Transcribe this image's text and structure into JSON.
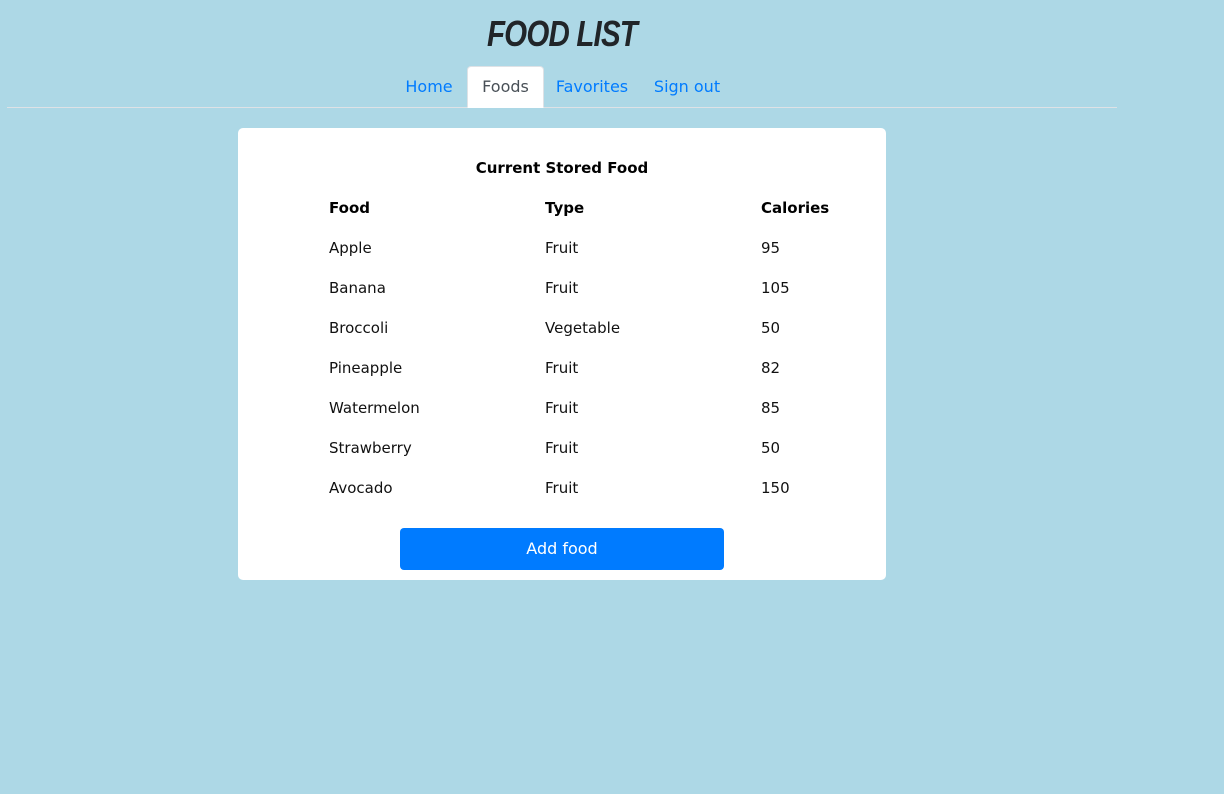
{
  "header": {
    "title": "FOOD LIST"
  },
  "nav": {
    "tabs": [
      {
        "label": "Home",
        "active": false
      },
      {
        "label": "Foods",
        "active": true
      },
      {
        "label": "Favorites",
        "active": false
      },
      {
        "label": "Sign out",
        "active": false
      }
    ]
  },
  "card": {
    "title": "Current Stored Food",
    "columns": [
      "Food",
      "Type",
      "Calories"
    ],
    "rows": [
      {
        "food": "Apple",
        "type": "Fruit",
        "calories": "95"
      },
      {
        "food": "Banana",
        "type": "Fruit",
        "calories": "105"
      },
      {
        "food": "Broccoli",
        "type": "Vegetable",
        "calories": "50"
      },
      {
        "food": "Pineapple",
        "type": "Fruit",
        "calories": "82"
      },
      {
        "food": "Watermelon",
        "type": "Fruit",
        "calories": "85"
      },
      {
        "food": "Strawberry",
        "type": "Fruit",
        "calories": "50"
      },
      {
        "food": "Avocado",
        "type": "Fruit",
        "calories": "150"
      }
    ],
    "add_button_label": "Add food"
  },
  "colors": {
    "background": "#add8e6",
    "accent": "#007bff",
    "card": "#ffffff",
    "active_tab_text": "#495057"
  }
}
